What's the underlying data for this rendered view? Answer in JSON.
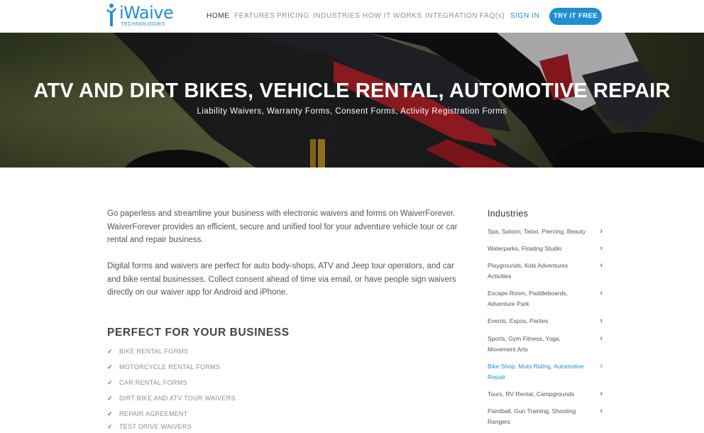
{
  "brand": {
    "name": "iWaive",
    "tagline": "TECHNOLOGIES",
    "color": "#1f8fd1"
  },
  "nav": {
    "items": [
      {
        "label": "HOME",
        "active": true
      },
      {
        "label": "FEATURES",
        "active": false
      },
      {
        "label": "PRICING",
        "active": false
      },
      {
        "label": "INDUSTRIES",
        "active": false
      },
      {
        "label": "HOW IT WORKS",
        "active": false
      },
      {
        "label": "INTEGRATION",
        "active": false
      },
      {
        "label": "FAQ(s)",
        "active": false
      }
    ],
    "signin": "SIGN IN",
    "cta": "TRY IT FREE"
  },
  "hero": {
    "title": "ATV AND DIRT BIKES, VEHICLE RENTAL, AUTOMOTIVE REPAIR",
    "subtitle": "Liability Waivers, Warranty Forms, Consent Forms, Activity Registration Forms"
  },
  "main": {
    "paragraphs": [
      "Go paperless and streamline your business with electronic waivers and forms on WaiverForever. WaiverForever provides an efficient, secure and unified tool for your adventure vehicle tour or car rental and repair business.",
      "Digital forms and waivers are perfect for auto body-shops, ATV and Jeep tour operators, and car and bike rental businesses. Collect consent ahead of time via email, or have people sign waivers directly on our waiver app for Android and iPhone."
    ],
    "section_title": "PERFECT FOR YOUR BUSINESS",
    "features": [
      "BIKE RENTAL FORMS",
      "MOTORCYCLE RENTAL FORMS",
      "CAR RENTAL FORMS",
      "DIRT BIKE AND ATV TOUR WAIVERS",
      "REPAIR AGREEMENT",
      "TEST DRIVE WAIVERS"
    ]
  },
  "sidebar": {
    "title": "Industries",
    "items": [
      {
        "label": "Spa, Saloon, Tatoo, Piercing, Beauty",
        "active": false
      },
      {
        "label": "Waterparks, Floating Studio",
        "active": false
      },
      {
        "label": "Playgrounds, Kids Adventures Activities",
        "active": false
      },
      {
        "label": "Escape Room, Paddleboards, Adventure Park",
        "active": false
      },
      {
        "label": "Events, Expos, Parties",
        "active": false
      },
      {
        "label": "Sports, Gym Fitness, Yoga, Movement Arts",
        "active": false
      },
      {
        "label": "Bike Shop, Moto Riding, Automotive Repair",
        "active": true
      },
      {
        "label": "Tours, RV Rental, Campgrounds",
        "active": false
      },
      {
        "label": "Paintball, Gun Training, Shooting Rangers",
        "active": false
      }
    ],
    "chevron": "›"
  },
  "icons": {
    "check": "✓",
    "logo_figure": "person-icon"
  }
}
